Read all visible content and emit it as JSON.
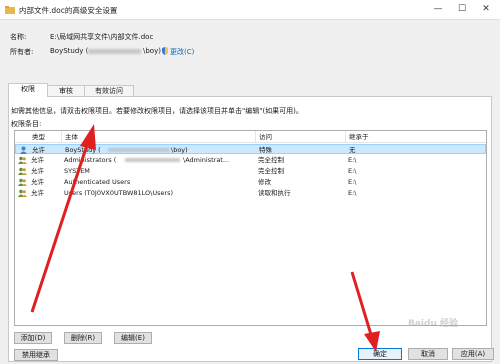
{
  "window": {
    "title": "内部文件.doc的高级安全设置",
    "minimize_glyph": "—",
    "maximize_glyph": "☐",
    "close_glyph": "✕"
  },
  "info": {
    "name_label": "名称:",
    "name_value": "E:\\局域网共享文件\\内部文件.doc",
    "owner_label": "所有者:",
    "owner_value": "BoyStudy (",
    "owner_value_end": "\\boy)",
    "change_link": "更改(C)"
  },
  "tabs": [
    {
      "label": "权限",
      "active": true
    },
    {
      "label": "审核",
      "active": false
    },
    {
      "label": "有效访问",
      "active": false
    }
  ],
  "instructions": "如需其他信息，请双击权限项目。若要修改权限项目，请选择该项目并单击\"编辑\"(如果可用)。",
  "entries_label": "权限条目:",
  "columns": [
    "类型",
    "主体",
    "访问",
    "继承于"
  ],
  "rows": [
    {
      "type": "允许",
      "principal": "BoyStudy (",
      "principal_end": "\\boy)",
      "access": "特殊",
      "inherited": "无",
      "selected": true
    },
    {
      "type": "允许",
      "principal": "Administrators (",
      "principal_end": "\\Administrat...",
      "access": "完全控制",
      "inherited": "E:\\",
      "selected": false
    },
    {
      "type": "允许",
      "principal": "SYSTEM",
      "principal_end": "",
      "access": "完全控制",
      "inherited": "E:\\",
      "selected": false
    },
    {
      "type": "允许",
      "principal": "Authenticated Users",
      "principal_end": "",
      "access": "修改",
      "inherited": "E:\\",
      "selected": false
    },
    {
      "type": "允许",
      "principal": "Users (T0J0VX0UTBW81LO\\Users)",
      "principal_end": "",
      "access": "读取和执行",
      "inherited": "E:\\",
      "selected": false
    }
  ],
  "buttons": {
    "add": "添加(D)",
    "remove": "删除(R)",
    "edit": "编辑(E)",
    "disable_inheritance": "禁用继承",
    "ok": "确定",
    "cancel": "取消",
    "apply": "应用(A)"
  },
  "watermark": "Baidu 经验",
  "colors": {
    "selection": "#cce8ff",
    "link": "#0b61b8",
    "arrow": "#e02020"
  }
}
